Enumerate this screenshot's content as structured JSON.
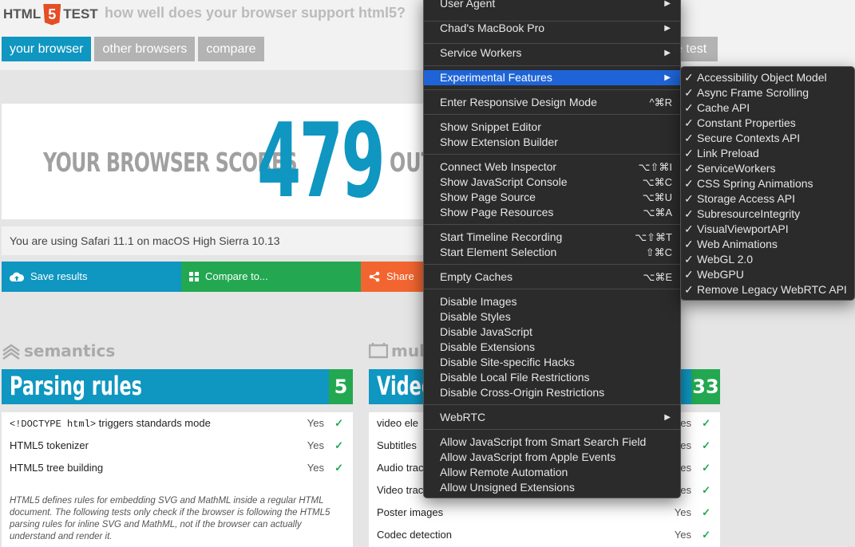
{
  "logo": {
    "text_left": "HTML",
    "badge": "5",
    "text_right": "TEST"
  },
  "tagline": "how well does your browser support html5?",
  "tabs": [
    {
      "label": "your browser"
    },
    {
      "label": "other browsers"
    },
    {
      "label": "compare"
    }
  ],
  "hidden_tab_label": "e test",
  "score": {
    "label": "YOUR BROWSER SCORES",
    "value": "479",
    "out": "OUT"
  },
  "using_text": "You are using Safari 11.1 on macOS High Sierra 10.13",
  "actions": {
    "save": "Save results",
    "compare": "Compare to...",
    "share": "Share"
  },
  "sections": {
    "left_category": "semantics",
    "right_category": "mul",
    "parsing": {
      "title": "Parsing rules",
      "score": "5",
      "rows": [
        {
          "code": "<!DOCTYPE html>",
          "label": " triggers standards mode",
          "result": "Yes"
        },
        {
          "code": "",
          "label": "HTML5 tokenizer",
          "result": "Yes"
        },
        {
          "code": "",
          "label": "HTML5 tree building",
          "result": "Yes"
        }
      ],
      "note": "HTML5 defines rules for embedding SVG and MathML inside a regular HTML document. The following tests only check if the browser is following the HTML5 parsing rules for inline SVG and MathML, not if the browser can actually understand and render it."
    },
    "video": {
      "title": "Video",
      "score": "33",
      "rows": [
        {
          "label": "video ele",
          "result": "Yes"
        },
        {
          "label": "Subtitles",
          "result": "Yes"
        },
        {
          "label": "Audio trac",
          "result": "Yes"
        },
        {
          "label": "Video trac",
          "result": "Yes"
        },
        {
          "label": "Poster images",
          "result": "Yes"
        },
        {
          "label": "Codec detection",
          "result": "Yes"
        }
      ]
    }
  },
  "menu": {
    "items": [
      {
        "label": "User Agent",
        "submenu": true
      },
      {
        "label": "Chad's MacBook Pro",
        "submenu": true
      },
      {
        "label": "Service Workers",
        "submenu": true
      },
      {
        "label": "Experimental Features",
        "submenu": true,
        "highlighted": true
      },
      {
        "label": "Enter Responsive Design Mode",
        "shortcut": "^⌘R"
      },
      {
        "label": "Show Snippet Editor"
      },
      {
        "label": "Show Extension Builder"
      },
      {
        "label": "Connect Web Inspector",
        "shortcut": "⌥⇧⌘I"
      },
      {
        "label": "Show JavaScript Console",
        "shortcut": "⌥⌘C"
      },
      {
        "label": "Show Page Source",
        "shortcut": "⌥⌘U"
      },
      {
        "label": "Show Page Resources",
        "shortcut": "⌥⌘A"
      },
      {
        "label": "Start Timeline Recording",
        "shortcut": "⌥⇧⌘T"
      },
      {
        "label": "Start Element Selection",
        "shortcut": "⇧⌘C"
      },
      {
        "label": "Empty Caches",
        "shortcut": "⌥⌘E"
      },
      {
        "label": "Disable Images"
      },
      {
        "label": "Disable Styles"
      },
      {
        "label": "Disable JavaScript"
      },
      {
        "label": "Disable Extensions"
      },
      {
        "label": "Disable Site-specific Hacks"
      },
      {
        "label": "Disable Local File Restrictions"
      },
      {
        "label": "Disable Cross-Origin Restrictions"
      },
      {
        "label": "WebRTC",
        "submenu": true
      },
      {
        "label": "Allow JavaScript from Smart Search Field"
      },
      {
        "label": "Allow JavaScript from Apple Events"
      },
      {
        "label": "Allow Remote Automation"
      },
      {
        "label": "Allow Unsigned Extensions"
      }
    ]
  },
  "experimental_features": [
    "Accessibility Object Model",
    "Async Frame Scrolling",
    "Cache API",
    "Constant Properties",
    "Secure Contexts API",
    "Link Preload",
    "ServiceWorkers",
    "CSS Spring Animations",
    "Storage Access API",
    "SubresourceIntegrity",
    "VisualViewportAPI",
    "Web Animations",
    "WebGL 2.0",
    "WebGPU",
    "Remove Legacy WebRTC API"
  ],
  "check_mark": "✓",
  "colors": {
    "blue": "#0f96c1",
    "green": "#23a851",
    "orange": "#f26530",
    "menu_bg": "#2b2b2b",
    "menu_highlight": "#1f64d6"
  }
}
